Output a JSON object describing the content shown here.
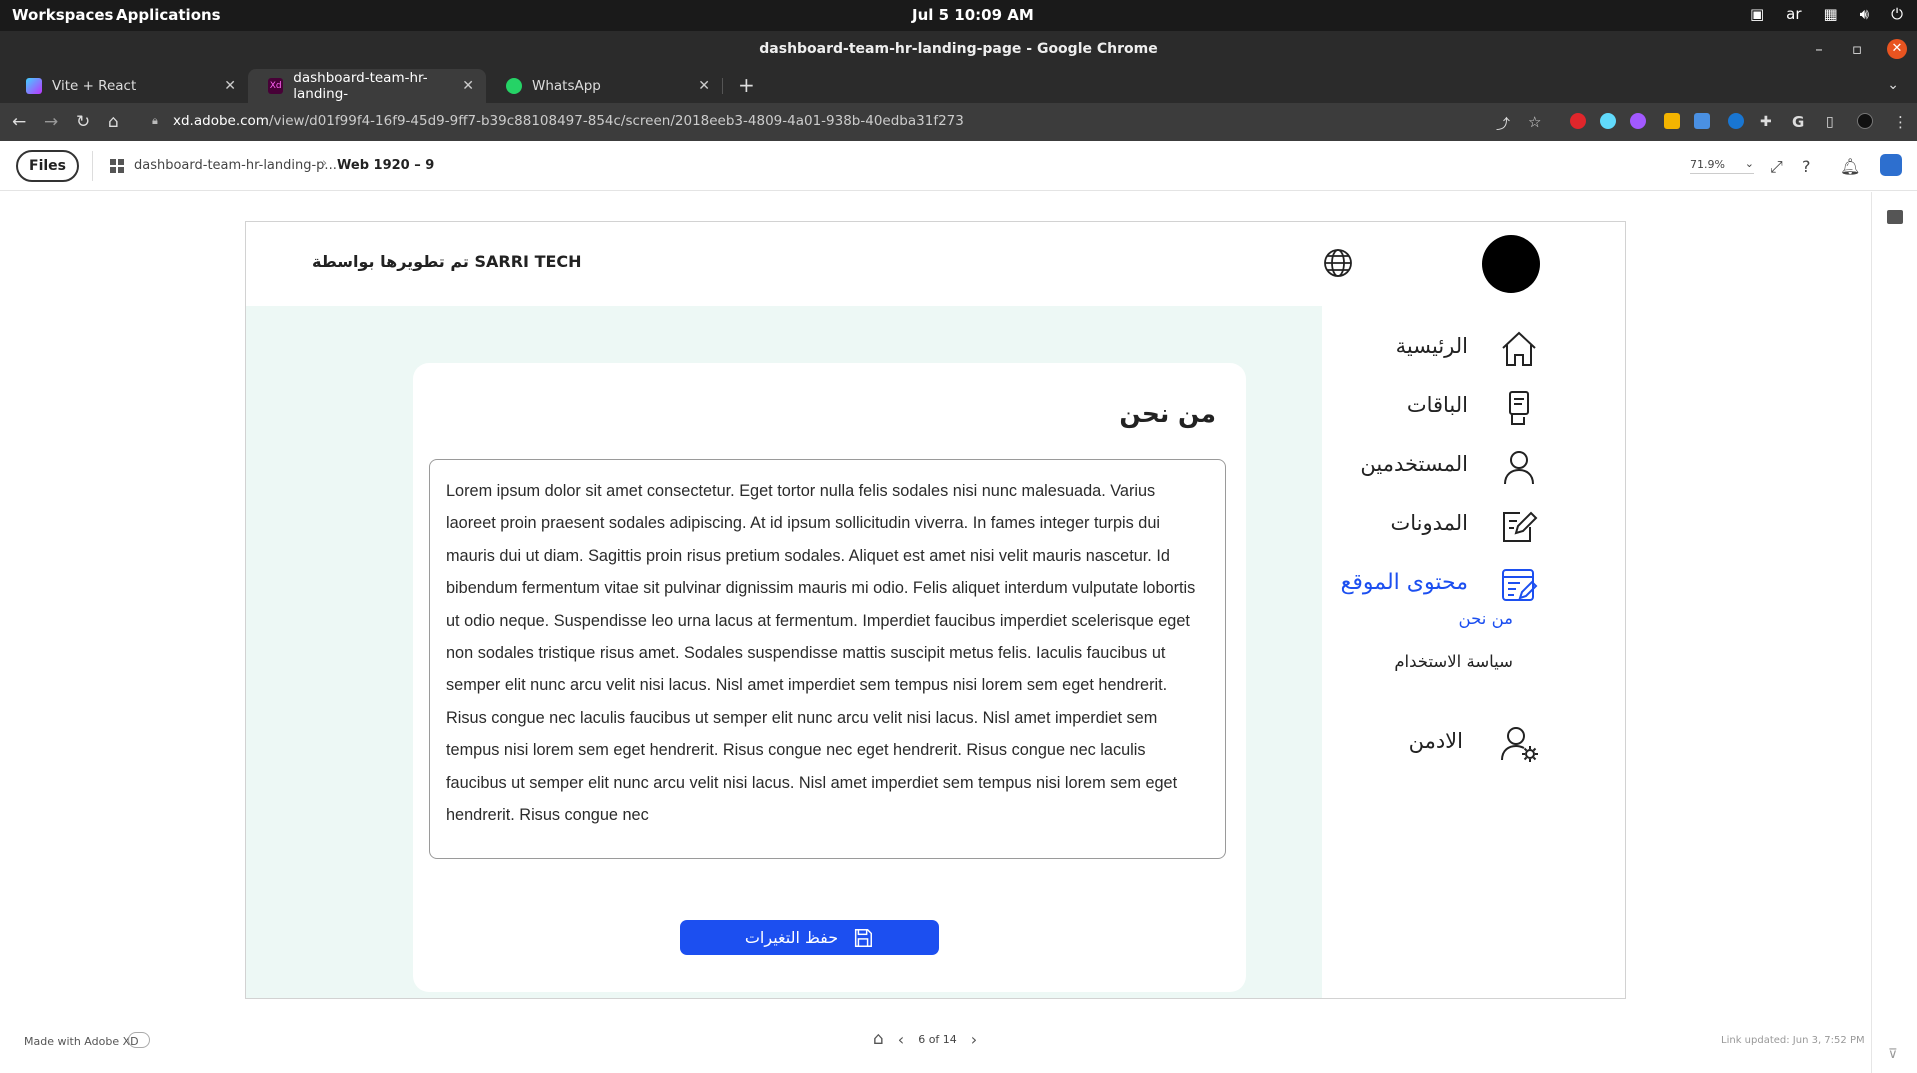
{
  "os": {
    "workspaces": "Workspaces",
    "applications": "Applications",
    "datetime": "Jul 5  10:09 AM",
    "keyboard_lang": "ar"
  },
  "window": {
    "title": "dashboard-team-hr-landing-page - Google Chrome"
  },
  "tabs": [
    {
      "label": "Vite + React",
      "icon": "vite-icon"
    },
    {
      "label": "dashboard-team-hr-landing-",
      "icon": "adobe-xd-icon",
      "active": true
    },
    {
      "label": "WhatsApp",
      "icon": "whatsapp-icon"
    }
  ],
  "address": {
    "host": "xd.adobe.com",
    "path": "/view/d01f99f4-16f9-45d9-9ff7-b39c88108497-854c/screen/2018eeb3-4809-4a01-938b-40edba31f273"
  },
  "xd": {
    "files_label": "Files",
    "breadcrumb_project": "dashboard-team-hr-landing-p...",
    "breadcrumb_screen": "Web 1920 – 9",
    "zoom": "71.9%",
    "made_with": "Made with Adobe XD",
    "page_indicator": "6 of 14",
    "link_updated": "Link updated: Jun 3, 7:52 PM"
  },
  "artboard": {
    "header": {
      "dev_credit": "تم تطويرها بواسطة SARRI TECH"
    },
    "card": {
      "title": "من نحن",
      "body": "Lorem ipsum dolor sit amet consectetur. Eget tortor nulla felis sodales nisi nunc malesuada. Varius laoreet proin praesent sodales adipiscing. At id ipsum sollicitudin viverra. In fames integer turpis dui mauris dui ut diam. Sagittis proin risus pretium sodales. Aliquet est amet nisi velit mauris nascetur. Id bibendum fermentum vitae sit pulvinar dignissim mauris mi odio. Felis aliquet interdum vulputate lobortis ut odio neque. Suspendisse leo urna lacus at fermentum. Imperdiet faucibus imperdiet scelerisque eget non sodales tristique risus amet. Sodales suspendisse mattis suscipit metus felis. Iaculis faucibus ut semper elit nunc arcu velit nisi lacus. Nisl amet imperdiet sem tempus nisi lorem sem eget hendrerit. Risus congue nec laculis faucibus ut semper elit nunc arcu velit nisi lacus. Nisl amet imperdiet sem tempus nisi lorem sem eget hendrerit. Risus congue nec eget hendrerit. Risus congue nec laculis faucibus ut semper elit nunc arcu velit nisi lacus. Nisl amet imperdiet sem tempus nisi lorem sem eget hendrerit. Risus congue nec",
      "save_label": "حفظ التغيرات"
    },
    "sidebar": {
      "home": "الرئيسية",
      "packages": "الباقات",
      "users": "المستخدمين",
      "blogs": "المدونات",
      "site_content": "محتوى الموقع",
      "sub_about": "من نحن",
      "sub_terms": "سياسة الاستخدام",
      "admin": "الادمن"
    }
  },
  "colors": {
    "accent": "#1c4ff0",
    "content_bg": "#edf8f5",
    "os_bar": "#1a1a1a"
  }
}
